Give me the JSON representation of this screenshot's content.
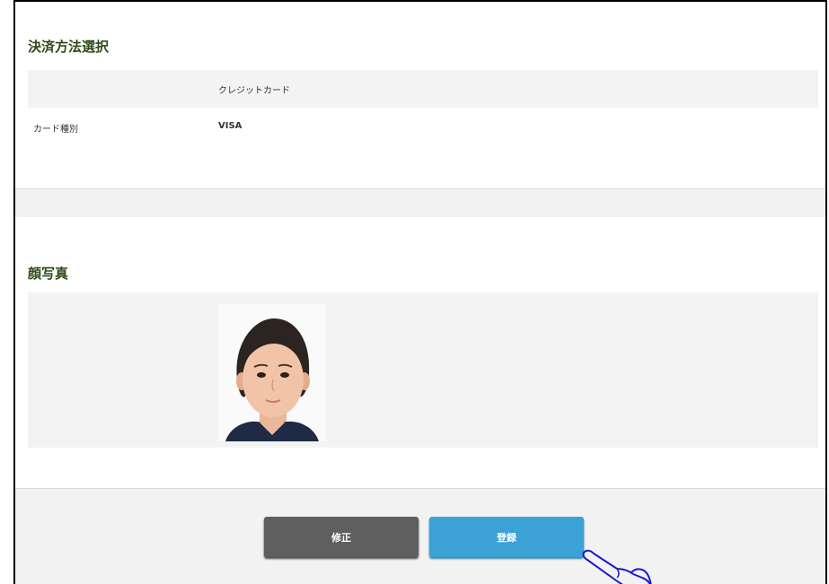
{
  "payment": {
    "title": "決済方法選択",
    "method_value": "クレジットカード",
    "card_label": "カード種別",
    "card_value": "VISA"
  },
  "photo": {
    "title": "顔写真"
  },
  "buttons": {
    "edit_label": "修正",
    "register_label": "登録"
  },
  "colors": {
    "title_green": "#2d4a17",
    "edit_gray": "#5f5f5f",
    "register_blue": "#3ca2d6",
    "row_gray": "#f3f3f3",
    "pointer_blue": "#1a1acc"
  }
}
